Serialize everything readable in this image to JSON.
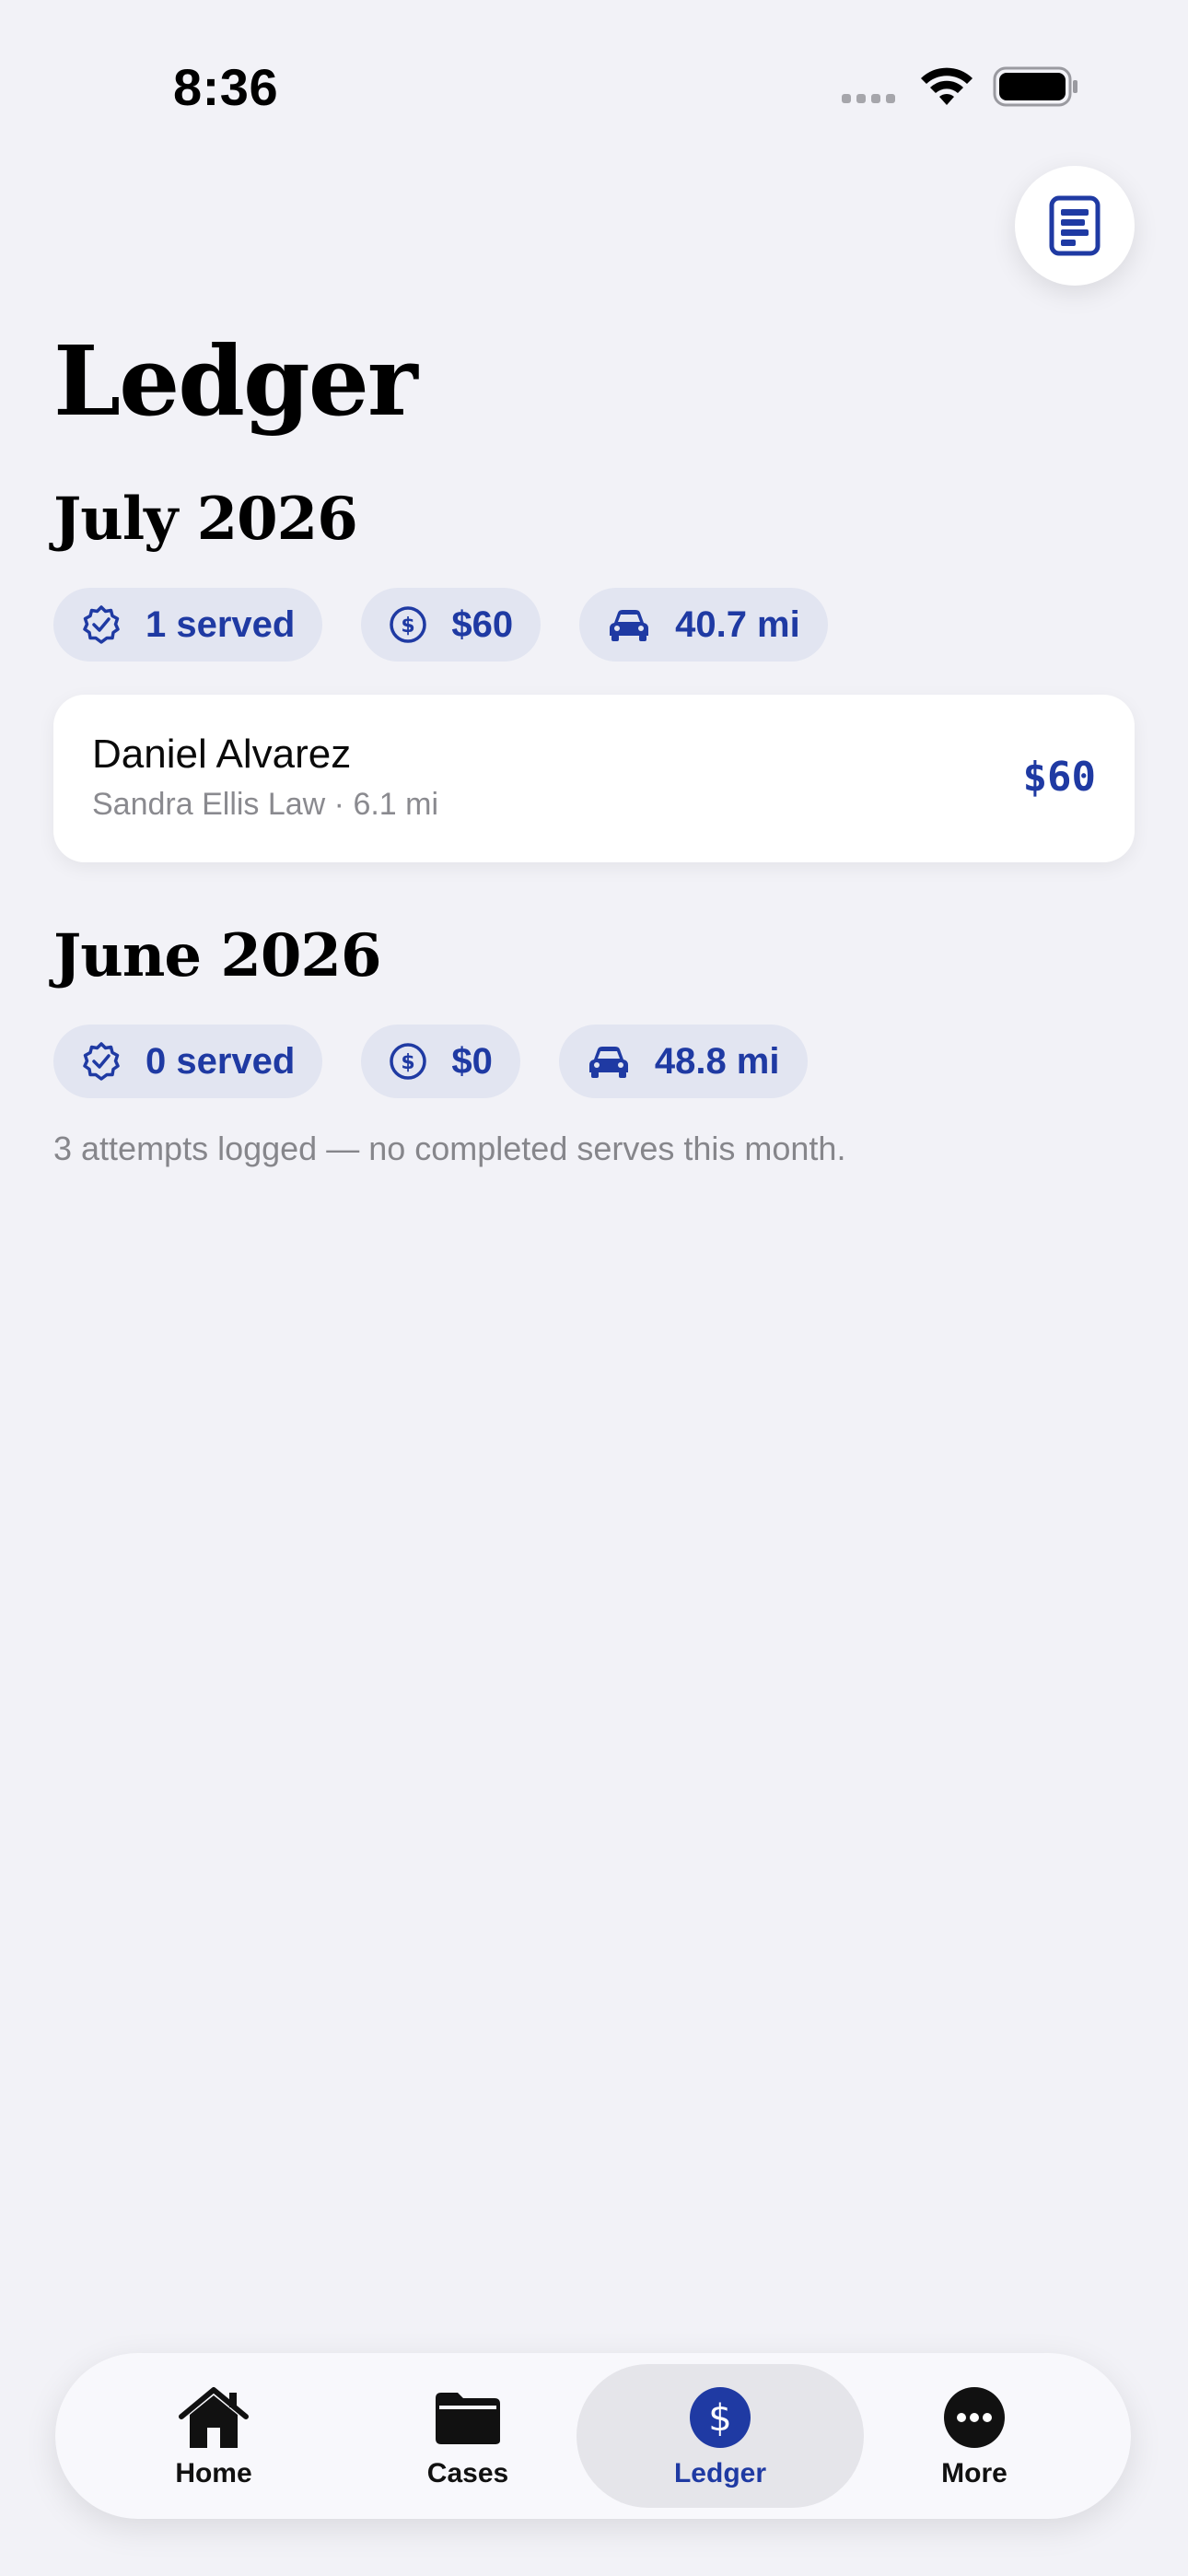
{
  "status_bar": {
    "time": "8:36"
  },
  "header": {
    "title": "Ledger",
    "report_button_icon": "report-document-icon"
  },
  "months": [
    {
      "heading": "July 2026",
      "chips": {
        "served": "1 served",
        "earnings": "$60",
        "mileage": "40.7 mi"
      },
      "entries": [
        {
          "name": "Daniel Alvarez",
          "subtitle": "Sandra Ellis Law · 6.1 mi",
          "amount": "$60"
        }
      ]
    },
    {
      "heading": "June 2026",
      "chips": {
        "served": "0 served",
        "earnings": "$0",
        "mileage": "48.8 mi"
      },
      "note": "3 attempts logged — no completed serves this month."
    }
  ],
  "tab_bar": {
    "tabs": [
      {
        "label": "Home",
        "icon": "house-icon"
      },
      {
        "label": "Cases",
        "icon": "folder-icon"
      },
      {
        "label": "Ledger",
        "icon": "dollar-circle-icon",
        "active": true
      },
      {
        "label": "More",
        "icon": "ellipsis-circle-icon"
      }
    ]
  },
  "colors": {
    "accent": "#1f3aa3",
    "background": "#f2f2f7",
    "chip_background": "#e2e5f1",
    "secondary_text": "#8a8a8f"
  }
}
